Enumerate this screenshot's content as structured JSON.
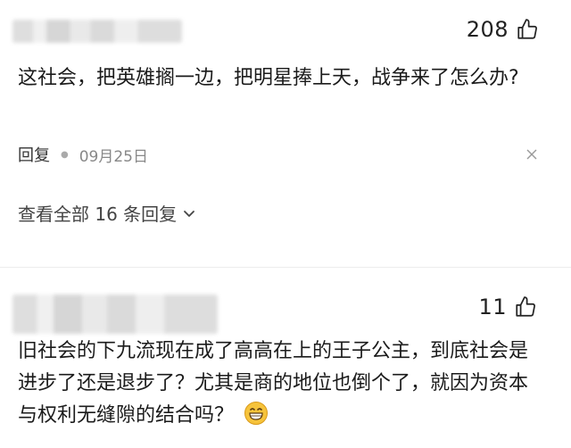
{
  "comments": [
    {
      "likes": "208",
      "text": "这社会，把英雄搁一边，把明星捧上天，战争来了怎么办?",
      "reply_label": "回复",
      "date": "09月25日",
      "expand_label": "查看全部 16 条回复"
    },
    {
      "likes": "11",
      "text": "旧社会的下九流现在成了高高在上的王子公主，到底社会是进步了还是退步了？尤其是商的地位也倒个了，就因为资本与权利无缝隙的结合吗？"
    }
  ],
  "icons": {
    "like": "thumbs-up-outline",
    "more": "close-x",
    "expand": "chevron-down",
    "emoji": "grinning-face"
  },
  "colors": {
    "text": "#1b1b1b",
    "meta": "#888888",
    "emoji_yellow": "#f6c33b"
  }
}
